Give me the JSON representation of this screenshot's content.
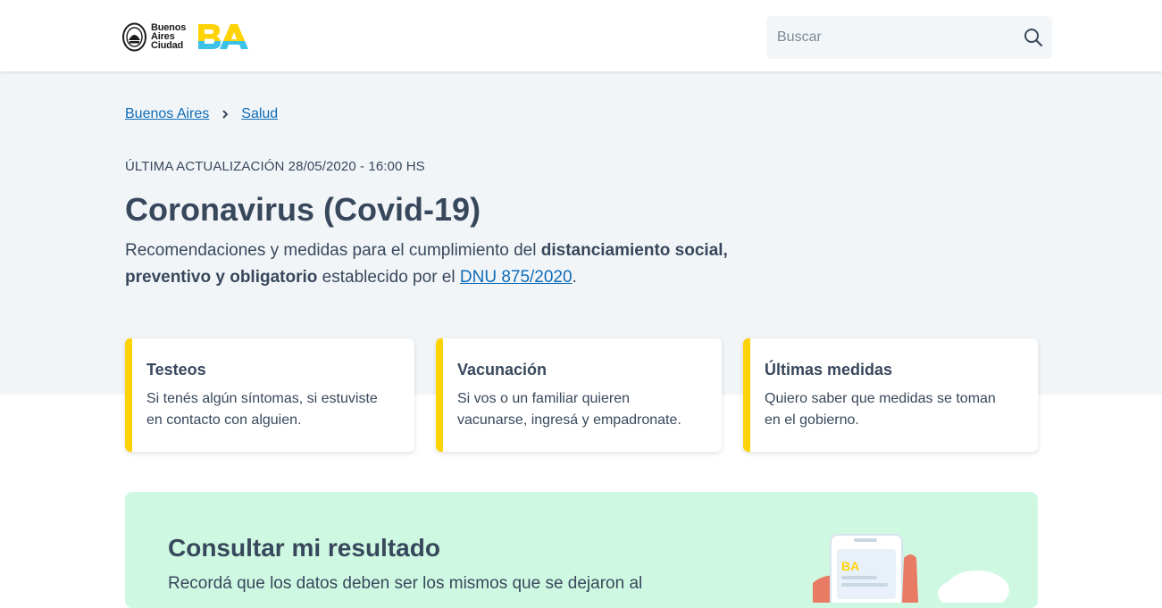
{
  "header": {
    "logo_text": [
      "Buenos",
      "Aires",
      "Ciudad"
    ],
    "search_placeholder": "Buscar"
  },
  "breadcrumb": [
    {
      "label": "Buenos Aires"
    },
    {
      "label": "Salud"
    }
  ],
  "page": {
    "updated": "ÚLTIMA ACTUALIZACIÓN 28/05/2020 - 16:00 HS",
    "title": "Coronavirus (Covid-19)",
    "lead_1": "Recomendaciones y medidas para el cumplimiento del ",
    "lead_bold": "distanciamiento social, preventivo y obligatorio",
    "lead_2": " establecido por el ",
    "lead_link": "DNU 875/2020",
    "lead_3": "."
  },
  "cards": [
    {
      "title": "Testeos",
      "text_1": "Si tenés algún síntomas, si estuviste",
      "text_2": "en contacto con alguien."
    },
    {
      "title": "Vacunación",
      "text_1": "Si vos o un familiar quieren",
      "text_2": "vacunarse, ingresá y empadronate."
    },
    {
      "title": "Últimas medidas",
      "text_1": "Quiero saber que medidas se toman",
      "text_2": "en el gobierno."
    }
  ],
  "result": {
    "title": "Consultar mi resultado",
    "text": "Recordá que los datos deben ser los mismos que se dejaron al"
  },
  "illustration_mark": "BA",
  "colors": {
    "accent_yellow": "#fdd306",
    "link_blue": "#0e6cb8",
    "hero_bg": "#f2f5f8",
    "result_bg": "#cff8e2",
    "text": "#38485c"
  },
  "icons": {
    "search": "search-icon",
    "breadcrumb_separator": "chevron-right-icon",
    "seal": "city-seal-icon"
  }
}
